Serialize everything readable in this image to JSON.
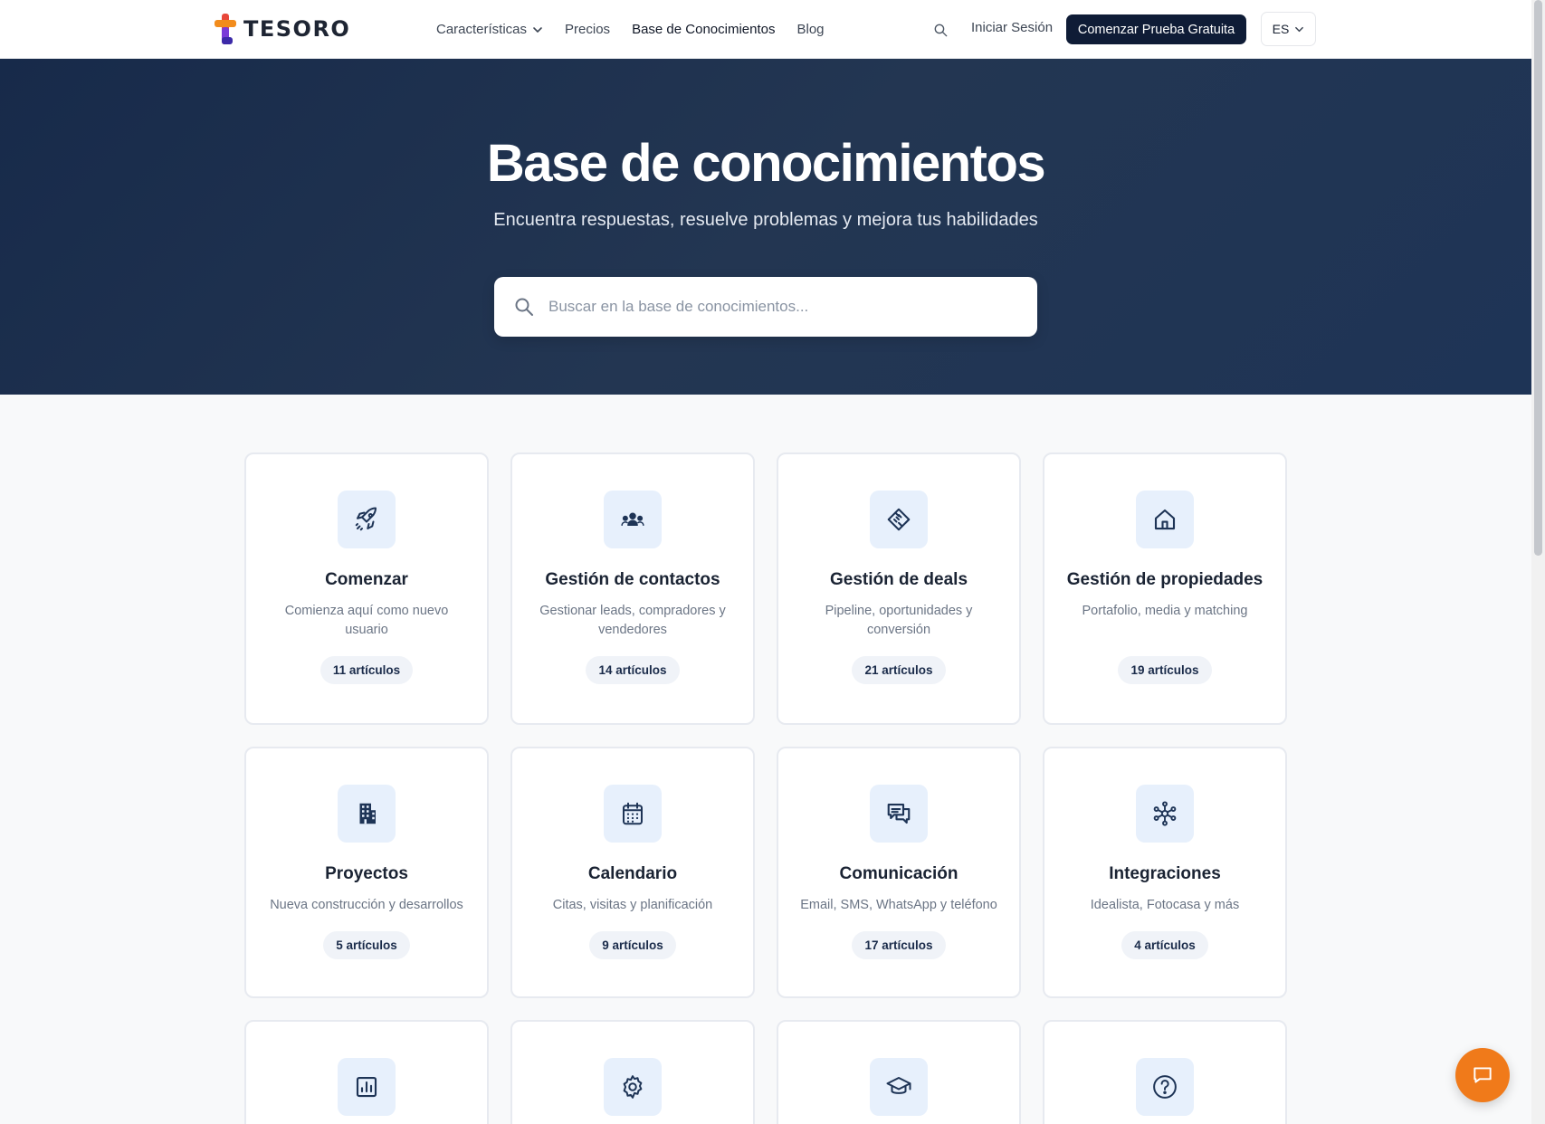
{
  "brand": {
    "name": "TESORO"
  },
  "nav": {
    "items": [
      {
        "label": "Características",
        "has_dropdown": true
      },
      {
        "label": "Precios"
      },
      {
        "label": "Base de Conocimientos",
        "active": true
      },
      {
        "label": "Blog"
      }
    ],
    "login_label": "Iniciar Sesión",
    "cta_label": "Comenzar Prueba Gratuita",
    "language": "ES"
  },
  "hero": {
    "title": "Base de conocimientos",
    "subtitle": "Encuentra respuestas, resuelve problemas y mejora tus habilidades",
    "search_placeholder": "Buscar en la base de conocimientos..."
  },
  "categories": [
    {
      "icon": "rocket-icon",
      "title": "Comenzar",
      "description": "Comienza aquí como nuevo usuario",
      "count": "11 artículos"
    },
    {
      "icon": "users-icon",
      "title": "Gestión de contactos",
      "description": "Gestionar leads, compradores y vendedores",
      "count": "14 artículos"
    },
    {
      "icon": "handshake-icon",
      "title": "Gestión de deals",
      "description": "Pipeline, oportunidades y conversión",
      "count": "21 artículos"
    },
    {
      "icon": "home-icon",
      "title": "Gestión de propiedades",
      "description": "Portafolio, media y matching",
      "count": "19 artículos"
    },
    {
      "icon": "building-icon",
      "title": "Proyectos",
      "description": "Nueva construcción y desarrollos",
      "count": "5 artículos"
    },
    {
      "icon": "calendar-icon",
      "title": "Calendario",
      "description": "Citas, visitas y planificación",
      "count": "9 artículos"
    },
    {
      "icon": "chat-icon",
      "title": "Comunicación",
      "description": "Email, SMS, WhatsApp y teléfono",
      "count": "17 artículos"
    },
    {
      "icon": "network-icon",
      "title": "Integraciones",
      "description": "Idealista, Fotocasa y más",
      "count": "4 artículos"
    },
    {
      "icon": "chart-icon"
    },
    {
      "icon": "gear-icon"
    },
    {
      "icon": "graduation-cap-icon"
    },
    {
      "icon": "help-circle-icon"
    }
  ],
  "colors": {
    "hero_bg": "#1e3456",
    "cta_bg": "#0f1c36",
    "icon_box_bg": "#e7f0fc",
    "icon_stroke": "#1e3456",
    "chat_fab": "#f07a1a"
  }
}
